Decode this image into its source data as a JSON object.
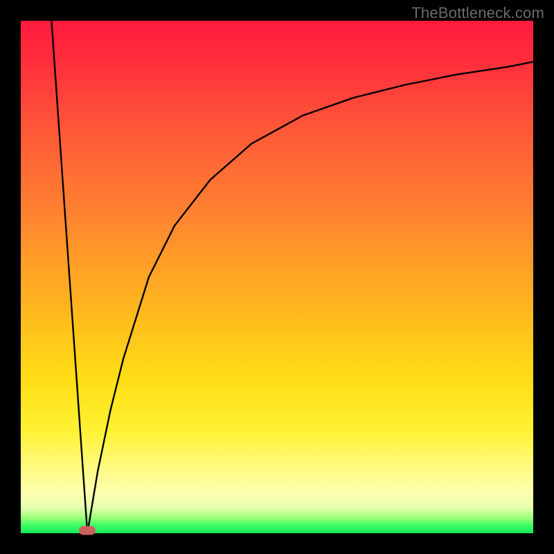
{
  "watermark": "TheBottleneck.com",
  "colors": {
    "frame": "#000000",
    "gradient_top": "#ff1a3c",
    "gradient_bottom": "#18e85a",
    "curve": "#000000",
    "marker": "#c9615e"
  },
  "chart_data": {
    "type": "line",
    "title": "",
    "xlabel": "",
    "ylabel": "",
    "xlim": [
      0,
      100
    ],
    "ylim": [
      0,
      100
    ],
    "grid": false,
    "legend": false,
    "marker_point": {
      "x": 13,
      "y": 0
    },
    "series": [
      {
        "name": "left-branch",
        "x": [
          6.0,
          7.0,
          8.0,
          9.0,
          10.0,
          11.0,
          12.0,
          13.0
        ],
        "y": [
          100.0,
          85.7,
          71.4,
          57.1,
          42.9,
          28.6,
          14.3,
          0.0
        ]
      },
      {
        "name": "right-branch",
        "x": [
          13.0,
          15.0,
          17.5,
          20.0,
          25.0,
          30.0,
          37.0,
          45.0,
          55.0,
          65.0,
          75.0,
          85.0,
          95.0,
          100.0
        ],
        "y": [
          0.0,
          12.0,
          24.0,
          34.0,
          50.0,
          60.0,
          69.0,
          76.0,
          81.5,
          85.0,
          87.5,
          89.5,
          91.0,
          92.0
        ]
      }
    ]
  }
}
